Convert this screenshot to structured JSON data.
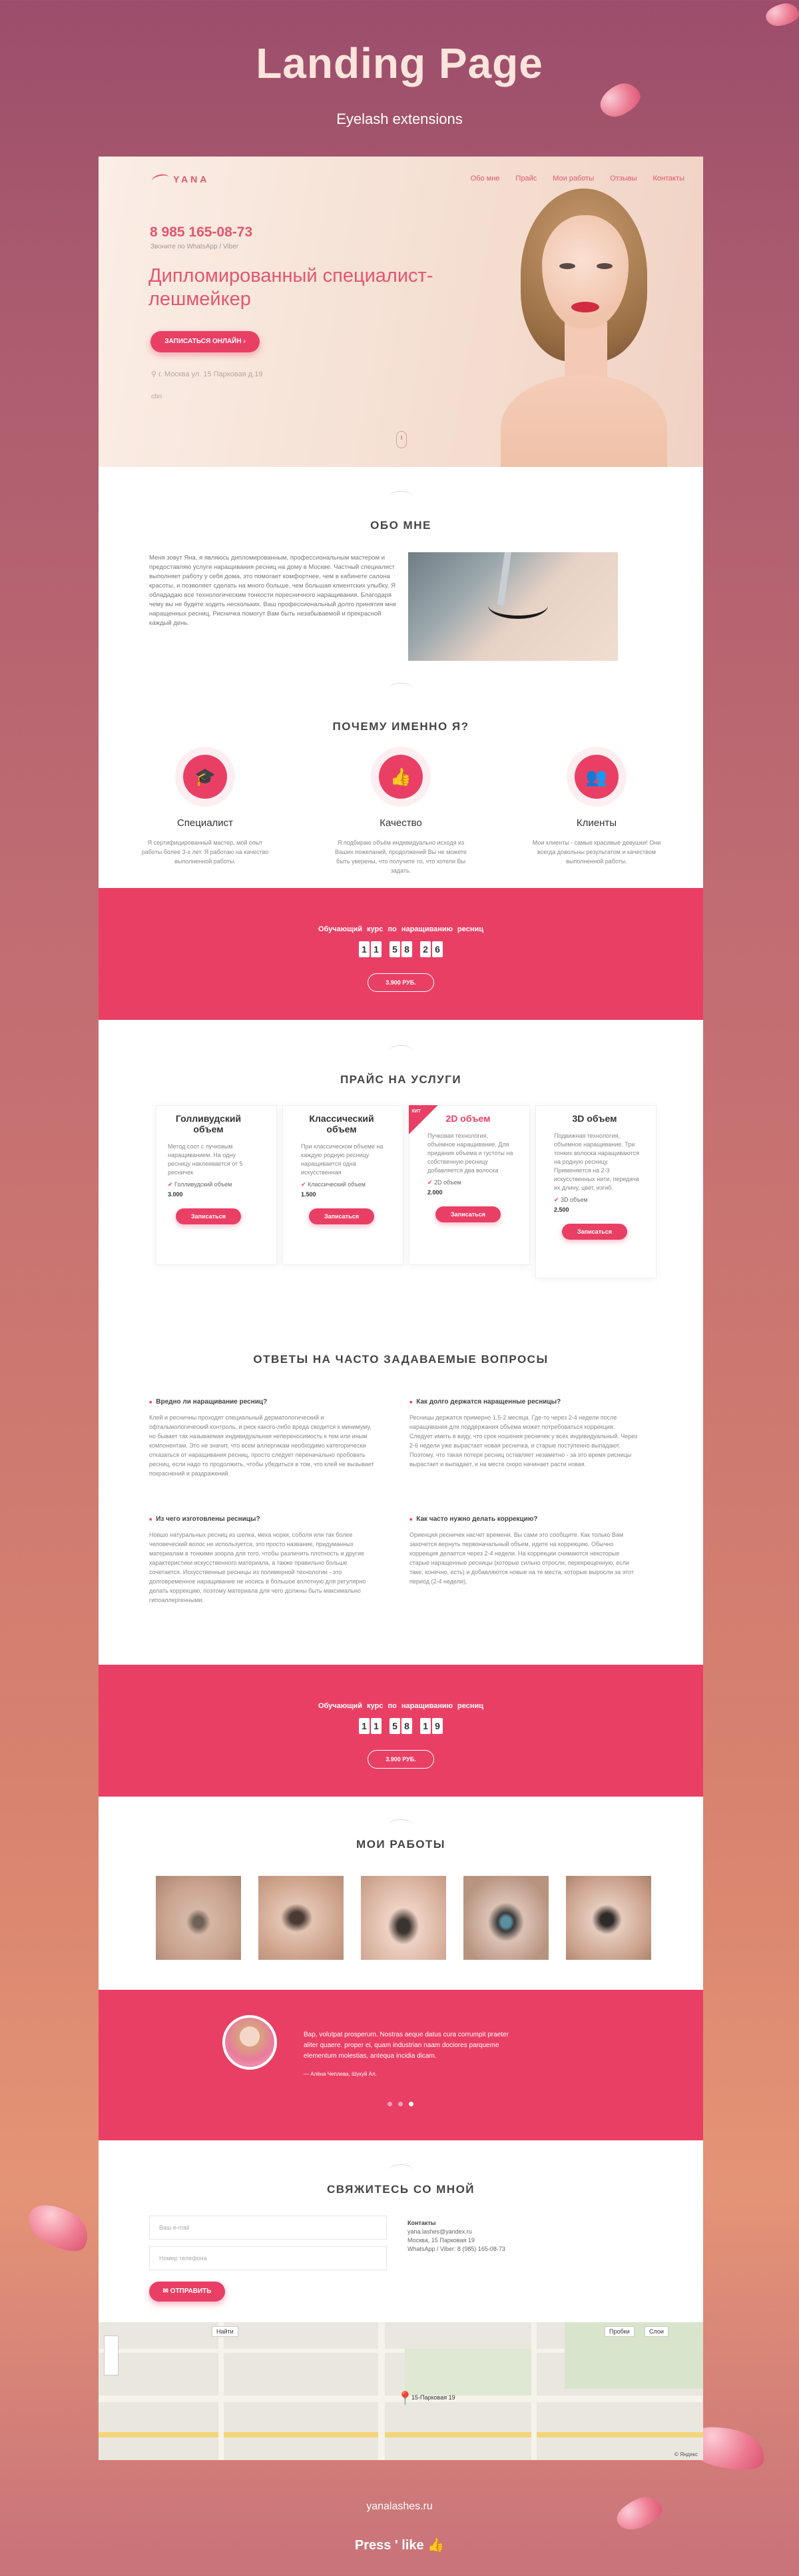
{
  "header": {
    "title": "Landing Page",
    "subtitle": "Eyelash extensions"
  },
  "hero": {
    "logo": "YANA",
    "nav": [
      "Обо мне",
      "Прайс",
      "Мои работы",
      "Отзывы",
      "Контакты"
    ],
    "phone": "8 985 165-08-73",
    "phone_note": "Звоните по WhatsApp / Viber",
    "headline": "Дипломированный специалист-лешмейкер",
    "cta": "ЗАПИСАТЬСЯ ОНЛАЙН ›",
    "address": "г. Москва ул. 15 Парковая д.19",
    "small": "cbn"
  },
  "about": {
    "title": "ОБО МНЕ",
    "text": "Меня зовут Яна, я являюсь дипломированным, профессиональным мастером и предоставляю услуги наращивания ресниц на дому в Москве. Частный специалист выполняет работу у себя дома, это помогает комфортнее, чем в кабинете салона красоты, и позволяет сделать на много больше, чем большая клиентских улыбку. Я облададаю все технологическим тонкости поресничного наращивания. Благодаря чему вы не будете ходить нескольких. Ваш профессиональный долго принятия мне наращенных ресниц. Рисничка помогут Вам быть незабываемой и прекрасной каждый день."
  },
  "why": {
    "title": "ПОЧЕМУ ИМЕННО Я?",
    "items": [
      {
        "icon": "graduation-cap-icon",
        "glyph": "🎓",
        "title": "Специалист",
        "text": "Я сертифицированный мастер, мой опыт работы более 3-х лет. Я работаю на качество выполненной работы."
      },
      {
        "icon": "thumbs-up-icon",
        "glyph": "👍",
        "title": "Качество",
        "text": "Я подбираю объём индивидуально исходя из Ваших пожеланий, продолжений Вы не можете быть уверены, что получите то, что хотели Вы задать."
      },
      {
        "icon": "users-icon",
        "glyph": "👥",
        "title": "Клиенты",
        "text": "Мои клиенты - самые красивые девушки! Они всегда довольны результатом и качеством выполненной работы."
      }
    ]
  },
  "promo1": {
    "label": "Обучающий курс по наращиванию ресниц",
    "digits": [
      "1",
      "1",
      "5",
      "8",
      "2",
      "6"
    ],
    "price": "3.900 РУБ."
  },
  "prices": {
    "title": "ПРАЙС НА УСЛУГИ",
    "ribbon": "ХИТ",
    "cards": [
      {
        "title": "Голливудский объем",
        "desc": "Метод соот с пучковым наращиванием. На одну ресницу наклеивается от 5 ресничек",
        "line": "Голливудский объем",
        "price": "3.000",
        "button": "Записаться"
      },
      {
        "title": "Классический объем",
        "desc": "При классическом объеме на каждую родную ресницу наращивается одна искусственная",
        "line": "Классический объем",
        "price": "1.500",
        "button": "Записаться"
      },
      {
        "title": "2D объем",
        "desc": "Пучковая технология, объемное наращивание. Для придания объема и густоты на собственную ресницу добавляется два волоска",
        "line": "2D объем",
        "price": "2.000",
        "button": "Записаться"
      },
      {
        "title": "3D объем",
        "desc": "Подвижная технология, объемное наращивание. Три тонких волоска наращиваются на родную ресницу. Применяется на 2-3 искусственных нити, передача их длину, цвет, изгиб.",
        "line": "3D объем",
        "price": "2.500",
        "button": "Записаться"
      }
    ]
  },
  "faq": {
    "title": "ОТВЕТЫ НА ЧАСТО ЗАДАВАЕМЫЕ ВОПРОСЫ",
    "items": [
      {
        "q": "Вредно ли наращивание ресниц?",
        "a": "Клей и ресничны проходят специальный дерматологический и офтальмологический контроль, и риск какого-либо вреда сводится к минимуму, но бывает так называемая индивидуальная непереносимость к тем или иным компонентам. Это не значит, что всем аллергикам необходимо категорически отказаться от наращивания ресниц, просто следует переначально пробовать ресниц, если надо то продолжить, чтобы убедиться в том, что клей не вызывает покраснений и раздражений."
      },
      {
        "q": "Как долго держатся наращенные ресницы?",
        "a": "Ресницы держатся примерно 1,5-2 месяца. Где-то через 2-4 недели после наращивания для поддержания объема может потребоваться коррекция. Следует иметь в виду, что срок ношения ресничек у всех индивидуальный. Через 2-6 недели уже вырастает новая ресничка, и старые поступенно выпадают. Поэтому, что такая потеря ресниц оставляет незаметно - за это время рисницы вырастает и выпадает, и на месте скоро начинает расти новая."
      },
      {
        "q": "Из чего изготовлены ресницы?",
        "a": "Новшо натуральных ресниц из шелка, меха норки, соболя или так более человеческий волос не используется, это просто название, придуманных материалам в тонкими зоорла для того, чтобы различить плотность и другие характеристики искусственного материала, а также правильно больше сочетается. Искусственные ресницы из полимерной технологии - это долговременное наращивание не носись в большое вплотную для регулярно делать коррекцию, поэтому материала для чего должны быть максимально гипоаллергенными."
      },
      {
        "q": "Как часто нужно делать коррекцию?",
        "a": "Ориенция ресничек насчет времени. Вы сами это сообщите. Как только Вам захочется вернуть первоначальный объем, идите на коррекцию. Обычно коррекция делается через 2-4 недели. На коррекции снимаются некоторые старые наращенные ресницы (которые сильно отросли, перекрещенную, если таке, конечно, есть) и добавляются новые на те места, которые выросли за этот период (2-4 недели)."
      }
    ]
  },
  "promo2": {
    "label": "Обучающий курс по наращиванию ресниц",
    "digits": [
      "1",
      "1",
      "5",
      "8",
      "1",
      "9"
    ],
    "price": "3.900 РУБ."
  },
  "works": {
    "title": "МОИ РАБОТЫ"
  },
  "testimonial": {
    "text": "Вар, volutpat prosperum. Nostras aeque datus cura corrumpit praeter aliter quaere. proper ei, quam industrian naam dociores parqueme elementum molestias, antequa incidia dicam.",
    "author": "— Алёна Чеплева, Шукуй Ал."
  },
  "contact": {
    "title": "СВЯЖИТЕСЬ СО МНОЙ",
    "email_placeholder": "Ваш e-mail",
    "phone_placeholder": "Номер телефона",
    "submit": "✉ ОТПРАВИТЬ",
    "info": [
      "Контакты",
      "yana.lashes@yandex.ru",
      "Москва, 15 Парковая 19",
      "WhatsApp / Viber: 8 (985) 165-08-73"
    ]
  },
  "map": {
    "search_btn": "Найти",
    "traffic": "Пробки",
    "layers": "Слои",
    "marker": "15-Парковая 19",
    "copyright": "© Яндекс"
  },
  "footer": {
    "site": "yanalashes.ru",
    "press": "Press ' like"
  },
  "colors": {
    "accent": "#ea3f64",
    "bg_top": "#9b4d6b",
    "bg_bottom": "#e49476"
  }
}
